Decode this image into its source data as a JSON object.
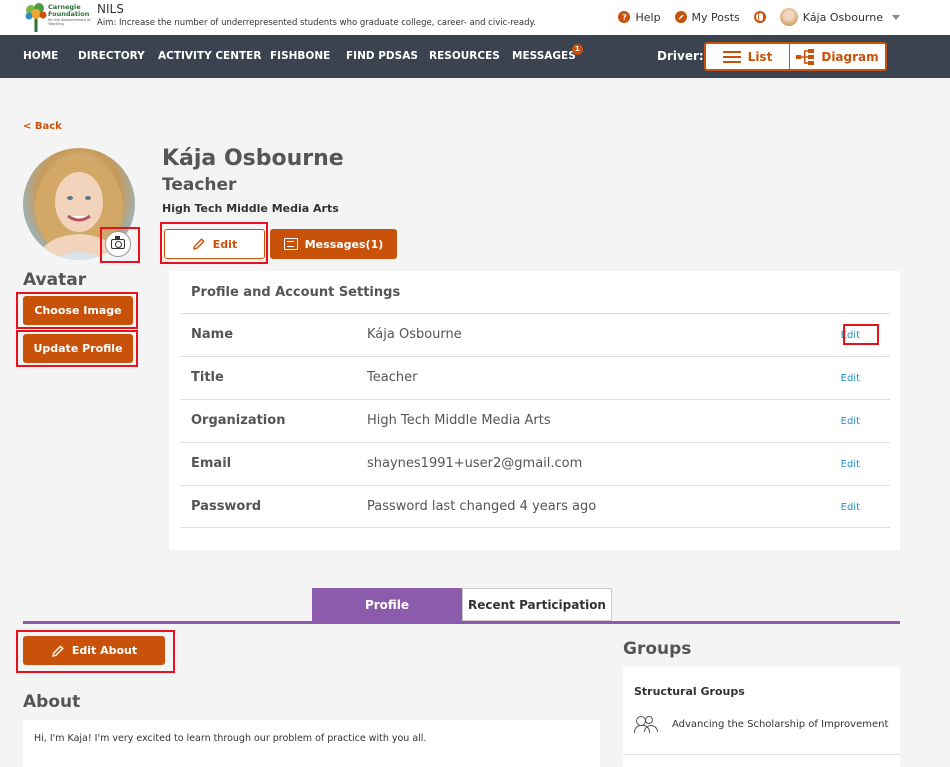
{
  "header": {
    "brand_name": "Carnegie Foundation",
    "brand_tagline": "for the Advancement of Teaching",
    "app_name": "NILS",
    "aim": "Aim: Increase the number of underrepresented students who graduate college, career- and civic-ready.",
    "help_label": "Help",
    "my_posts_label": "My Posts",
    "user_name": "Kája Osbourne"
  },
  "nav": {
    "items": [
      {
        "label": "HOME"
      },
      {
        "label": "DIRECTORY"
      },
      {
        "label": "ACTIVITY CENTER"
      },
      {
        "label": "FISHBONE"
      },
      {
        "label": "FIND PDSAS"
      },
      {
        "label": "RESOURCES"
      },
      {
        "label": "MESSAGES",
        "badge": "1"
      }
    ],
    "driver_label": "Driver:",
    "driver_list_label": "List",
    "driver_diagram_label": "Diagram"
  },
  "profile": {
    "back_label": "< Back",
    "name": "Kája Osbourne",
    "title": "Teacher",
    "organization": "High Tech Middle Media Arts",
    "edit_label": "Edit",
    "messages_label": "Messages(1)",
    "avatar_heading": "Avatar",
    "choose_image_label": "Choose Image",
    "update_profile_label": "Update Profile"
  },
  "settings": {
    "title": "Profile and Account Settings",
    "edit_link": "Edit",
    "rows": [
      {
        "label": "Name",
        "value": "Kája Osbourne"
      },
      {
        "label": "Title",
        "value": "Teacher"
      },
      {
        "label": "Organization",
        "value": "High Tech Middle Media Arts"
      },
      {
        "label": "Email",
        "value": "shaynes1991+user2@gmail.com"
      },
      {
        "label": "Password",
        "value": "Password last changed 4 years ago"
      }
    ]
  },
  "tabs": {
    "profile": "Profile",
    "recent": "Recent Participation"
  },
  "about": {
    "edit_label": "Edit About",
    "title": "About",
    "text": "Hi, I'm Kaja! I'm very excited to learn through our problem of practice with you all."
  },
  "groups": {
    "title": "Groups",
    "subtitle": "Structural Groups",
    "items": [
      {
        "label": "Advancing the Scholarship of Improvement"
      }
    ]
  },
  "colors": {
    "accent": "#c9520a",
    "nav_bg": "#3b4350",
    "tab_active": "#8c5bab",
    "link": "#2a8fc7",
    "highlight": "#e8121e"
  }
}
